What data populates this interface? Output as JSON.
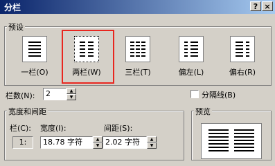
{
  "window": {
    "title": "分栏",
    "help_label": "?",
    "close_label": "×"
  },
  "presets": {
    "group_label": "预设",
    "items": [
      {
        "label": "一栏(O)"
      },
      {
        "label": "两栏(W)"
      },
      {
        "label": "三栏(T)"
      },
      {
        "label": "偏左(L)"
      },
      {
        "label": "偏右(R)"
      }
    ],
    "selected": "两栏(W)"
  },
  "columns": {
    "label": "栏数(N):",
    "value": "2"
  },
  "separator": {
    "label": "分隔线(B)",
    "checked": false
  },
  "width_spacing": {
    "group_label": "宽度和间距",
    "col_header": "栏(C):",
    "width_header": "宽度(I):",
    "spacing_header": "间距(S):",
    "row1": {
      "col": "1:",
      "width": "18.78 字符",
      "spacing": "2.02 字符"
    }
  },
  "preview": {
    "group_label": "预览"
  },
  "colors": {
    "selection": "#e8261f",
    "titlebar": "#0a246a"
  }
}
